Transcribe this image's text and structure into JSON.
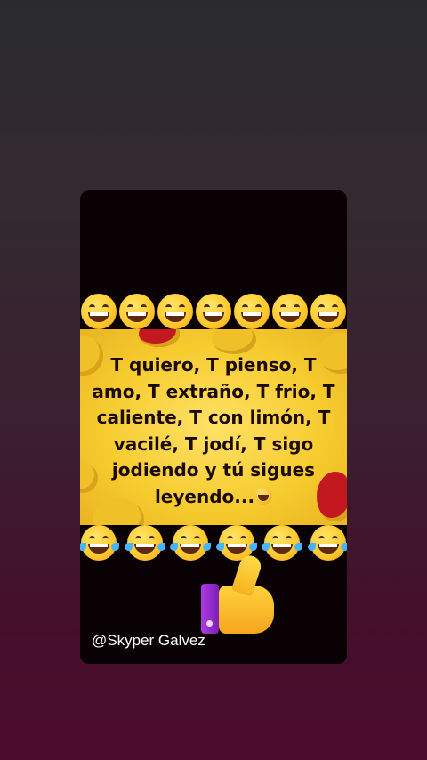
{
  "meme": {
    "text_before_emoji": "T quiero, T pienso, T amo, T extraño, T frio, T caliente, T con limón, T vacilé, T jodí, T sigo jodiendo y tú sigues leyendo...",
    "inline_icon": "laughing-face-icon"
  },
  "emoji_rows": {
    "top": [
      "grinning-squinting-face-icon",
      "beaming-face-icon",
      "beaming-face-icon",
      "beaming-face-icon",
      "beaming-face-icon",
      "grinning-face-icon",
      "grinning-face-icon"
    ],
    "bottom": [
      "rolling-laughing-face-icon",
      "rolling-laughing-face-icon",
      "rolling-laughing-face-icon",
      "rolling-laughing-face-icon",
      "rolling-laughing-face-icon",
      "rolling-laughing-face-icon"
    ]
  },
  "thumbs_icon": "thumbs-up-icon",
  "watermark": "@Skyper Galvez",
  "colors": {
    "panel_yellow": "#f6cb2e",
    "card_background": "#0a0105",
    "cuff_purple": "#9b2fd0"
  }
}
